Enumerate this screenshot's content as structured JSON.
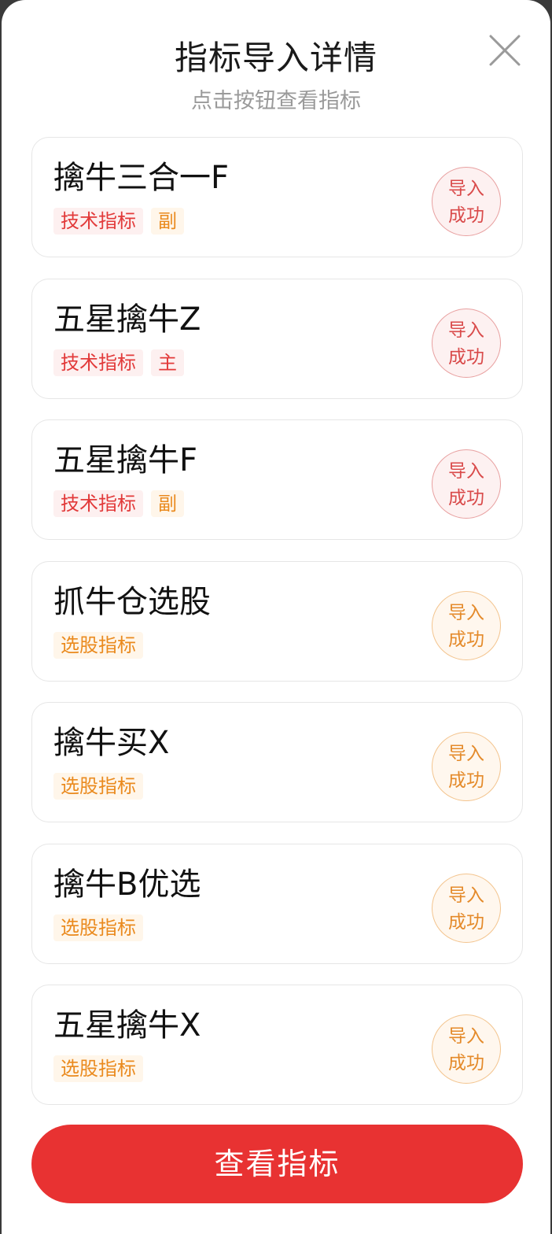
{
  "header": {
    "title": "指标导入详情",
    "subtitle": "点击按钮查看指标"
  },
  "items": [
    {
      "name": "擒牛三合一F",
      "tags": [
        {
          "label": "技术指标",
          "tone": "red"
        },
        {
          "label": "副",
          "tone": "orange"
        }
      ],
      "status": [
        "导入",
        "成功"
      ],
      "tone": "red"
    },
    {
      "name": "五星擒牛Z",
      "tags": [
        {
          "label": "技术指标",
          "tone": "red"
        },
        {
          "label": "主",
          "tone": "red"
        }
      ],
      "status": [
        "导入",
        "成功"
      ],
      "tone": "red"
    },
    {
      "name": "五星擒牛F",
      "tags": [
        {
          "label": "技术指标",
          "tone": "red"
        },
        {
          "label": "副",
          "tone": "orange"
        }
      ],
      "status": [
        "导入",
        "成功"
      ],
      "tone": "red"
    },
    {
      "name": "抓牛仓选股",
      "tags": [
        {
          "label": "选股指标",
          "tone": "orange"
        }
      ],
      "status": [
        "导入",
        "成功"
      ],
      "tone": "orange"
    },
    {
      "name": "擒牛买X",
      "tags": [
        {
          "label": "选股指标",
          "tone": "orange"
        }
      ],
      "status": [
        "导入",
        "成功"
      ],
      "tone": "orange"
    },
    {
      "name": "擒牛B优选",
      "tags": [
        {
          "label": "选股指标",
          "tone": "orange"
        }
      ],
      "status": [
        "导入",
        "成功"
      ],
      "tone": "orange"
    },
    {
      "name": "五星擒牛X",
      "tags": [
        {
          "label": "选股指标",
          "tone": "orange"
        }
      ],
      "status": [
        "导入",
        "成功"
      ],
      "tone": "orange"
    }
  ],
  "footer": {
    "view_button_label": "查看指标"
  },
  "colors": {
    "accent_red": "#e83232",
    "tag_red": "#e23a3a",
    "tag_orange": "#ea8a1e"
  },
  "icons": {
    "close": "close-icon"
  }
}
